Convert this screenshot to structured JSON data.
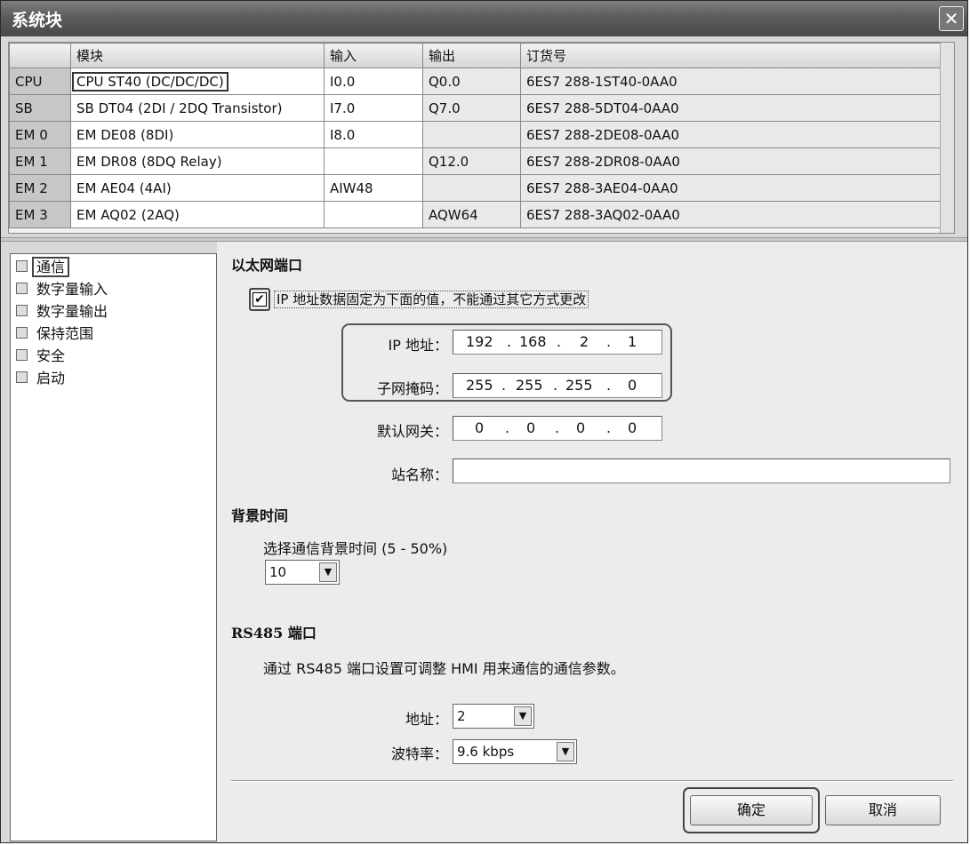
{
  "window": {
    "title": "系统块",
    "close_glyph": "✕"
  },
  "table": {
    "headers": [
      "模块",
      "输入",
      "输出",
      "订货号"
    ],
    "rows": [
      {
        "slot": "CPU",
        "module": "CPU ST40 (DC/DC/DC)",
        "input": "I0.0",
        "output": "Q0.0",
        "order": "6ES7 288-1ST40-0AA0"
      },
      {
        "slot": "SB",
        "module": "SB DT04 (2DI / 2DQ Transistor)",
        "input": "I7.0",
        "output": "Q7.0",
        "order": "6ES7 288-5DT04-0AA0"
      },
      {
        "slot": "EM 0",
        "module": "EM DE08 (8DI)",
        "input": "I8.0",
        "output": "",
        "order": "6ES7 288-2DE08-0AA0"
      },
      {
        "slot": "EM 1",
        "module": "EM DR08 (8DQ Relay)",
        "input": "",
        "output": "Q12.0",
        "order": "6ES7 288-2DR08-0AA0"
      },
      {
        "slot": "EM 2",
        "module": "EM AE04 (4AI)",
        "input": "AIW48",
        "output": "",
        "order": "6ES7 288-3AE04-0AA0"
      },
      {
        "slot": "EM 3",
        "module": "EM AQ02 (2AQ)",
        "input": "",
        "output": "AQW64",
        "order": "6ES7 288-3AQ02-0AA0"
      }
    ]
  },
  "nav": {
    "items": [
      {
        "label": "通信",
        "checked": true
      },
      {
        "label": "数字量输入",
        "checked": false
      },
      {
        "label": "数字量输出",
        "checked": false
      },
      {
        "label": "保持范围",
        "checked": false
      },
      {
        "label": "安全",
        "checked": false
      },
      {
        "label": "启动",
        "checked": false
      }
    ]
  },
  "ethernet": {
    "title": "以太网端口",
    "fixed_ip_label": "IP 地址数据固定为下面的值，不能通过其它方式更改",
    "fixed_ip_checked": true,
    "check_glyph": "✔",
    "ip_label": "IP 地址：",
    "ip": [
      "192",
      "168",
      "2",
      "1"
    ],
    "mask_label": "子网掩码：",
    "mask": [
      "255",
      "255",
      "255",
      "0"
    ],
    "gateway_label": "默认网关：",
    "gateway": [
      "0",
      "0",
      "0",
      "0"
    ],
    "station_label": "站名称：",
    "station_value": "",
    "octet_sep": "."
  },
  "background": {
    "title": "背景时间",
    "label": "选择通信背景时间 (5 - 50%)",
    "value": "10"
  },
  "rs485": {
    "title": "RS485 端口",
    "desc": "通过 RS485 端口设置可调整 HMI 用来通信的通信参数。",
    "address_label": "地址：",
    "address_value": "2",
    "baud_label": "波特率：",
    "baud_value": "9.6 kbps"
  },
  "dropdown_glyph": "▼",
  "buttons": {
    "ok": "确定",
    "cancel": "取消"
  }
}
